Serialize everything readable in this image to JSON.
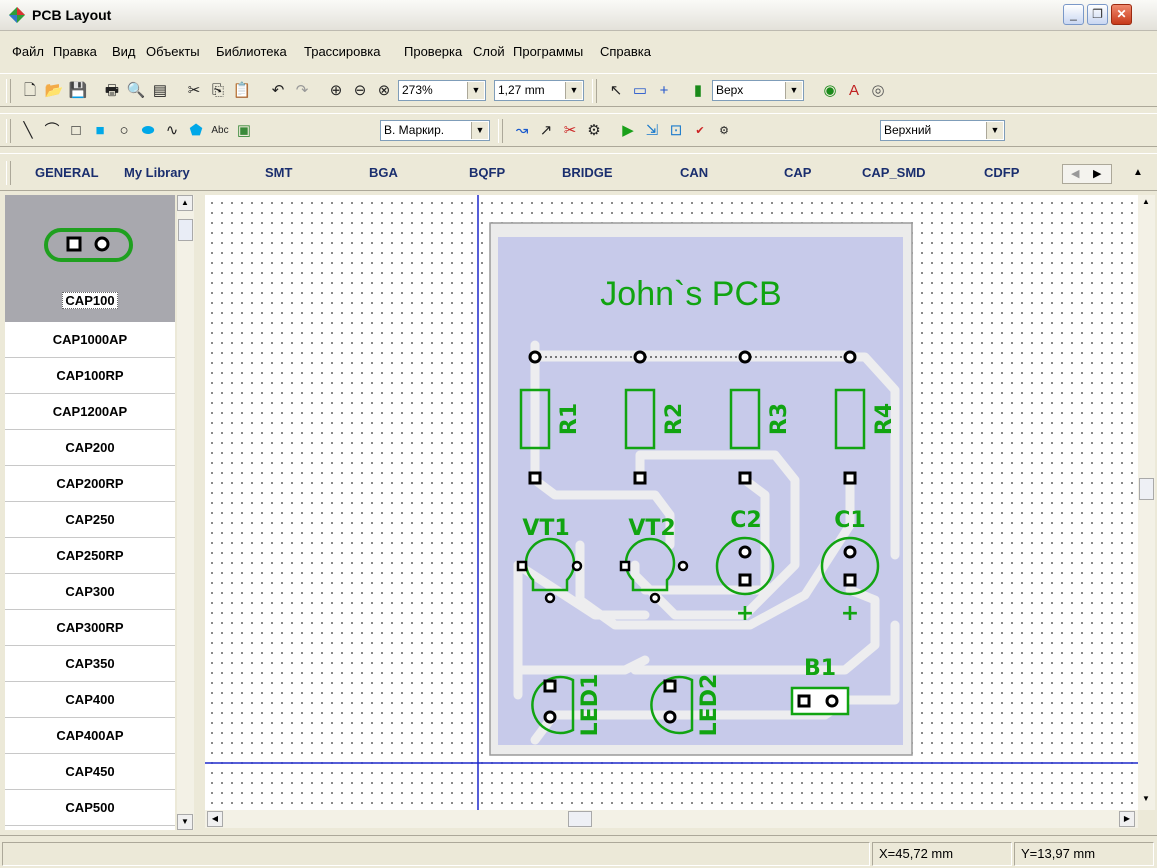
{
  "window": {
    "title": "PCB Layout"
  },
  "menu": [
    "Файл",
    "Правка",
    "Вид",
    "Объекты",
    "Библиотека",
    "Трассировка",
    "Проверка",
    "Слой",
    "Программы",
    "Справка"
  ],
  "toolbar": {
    "zoom_value": "273%",
    "grid_value": "1,27 mm",
    "layer_value": "Верх",
    "text_layer_value": "В. Маркир.",
    "side_value": "Верхний",
    "text_tool_label": "Abc"
  },
  "library_tabs": [
    "GENERAL",
    "My Library",
    "SMT",
    "BGA",
    "BQFP",
    "BRIDGE",
    "CAN",
    "CAP",
    "CAP_SMD",
    "CDFP"
  ],
  "components": [
    "CAP100",
    "CAP1000AP",
    "CAP100RP",
    "CAP1200AP",
    "CAP200",
    "CAP200RP",
    "CAP250",
    "CAP250RP",
    "CAP300",
    "CAP300RP",
    "CAP350",
    "CAP400",
    "CAP400AP",
    "CAP450",
    "CAP500"
  ],
  "selected_component": "CAP100",
  "board": {
    "title": "John`s PCB",
    "resistors": [
      "R1",
      "R2",
      "R3",
      "R4"
    ],
    "transistors": [
      "VT1",
      "VT2"
    ],
    "capacitors": [
      "C2",
      "C1"
    ],
    "leds": [
      "LED1",
      "LED2"
    ],
    "connector": "B1",
    "plus_sign": "+"
  },
  "status": {
    "x": "X=45,72 mm",
    "y": "Y=13,97 mm"
  },
  "colors": {
    "board": "#C7CAEA",
    "track": "#EDEDEF",
    "silkscreen": "#11A411",
    "canvas": "#FFFFFF"
  }
}
